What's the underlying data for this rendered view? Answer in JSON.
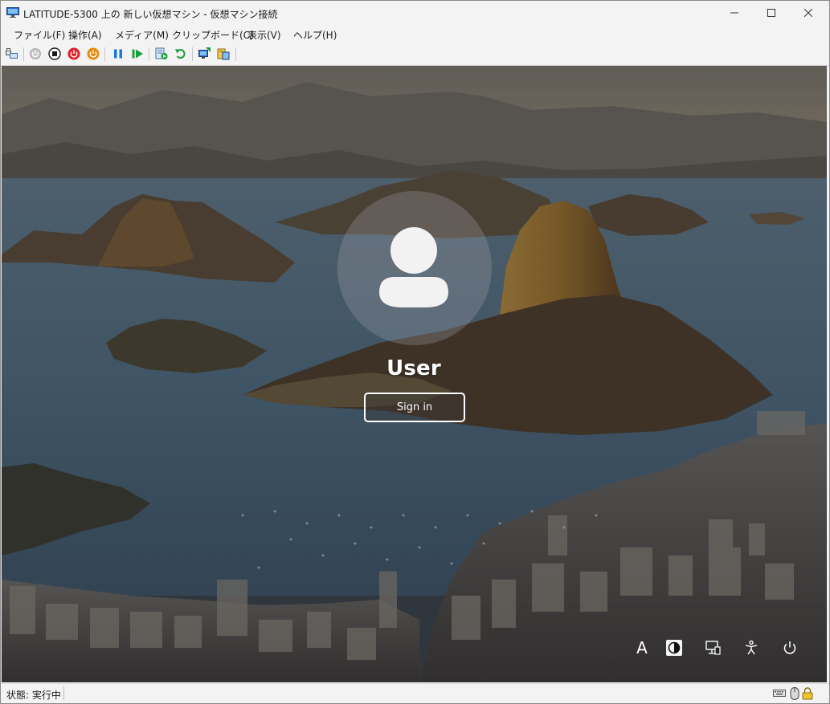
{
  "window": {
    "title": "LATITUDE-5300 上の 新しい仮想マシン - 仮想マシン接続"
  },
  "menu": {
    "items": [
      "ファイル(F)",
      "操作(A)",
      "メディア(M)",
      "クリップボード(C)",
      "表示(V)",
      "ヘルプ(H)"
    ]
  },
  "toolbar": {
    "icons": [
      "ctrl-alt-del-icon",
      "start-icon",
      "turn-off-icon",
      "shut-down-icon",
      "save-state-icon",
      "pause-icon",
      "resume-icon",
      "checkpoint-icon",
      "revert-icon",
      "enhanced-session-icon",
      "share-icon"
    ],
    "colors": {
      "shutdown": "#e0202a",
      "save": "#e88a12",
      "pause": "#1c78d4",
      "resume": "#1a9e3a"
    }
  },
  "lockscreen": {
    "username": "User",
    "signin_label": "Sign in",
    "corner_icons": [
      "language-icon",
      "contrast-icon",
      "network-icon",
      "accessibility-icon",
      "power-icon"
    ],
    "language_label": "A"
  },
  "statusbar": {
    "status_text": "状態: 実行中"
  }
}
